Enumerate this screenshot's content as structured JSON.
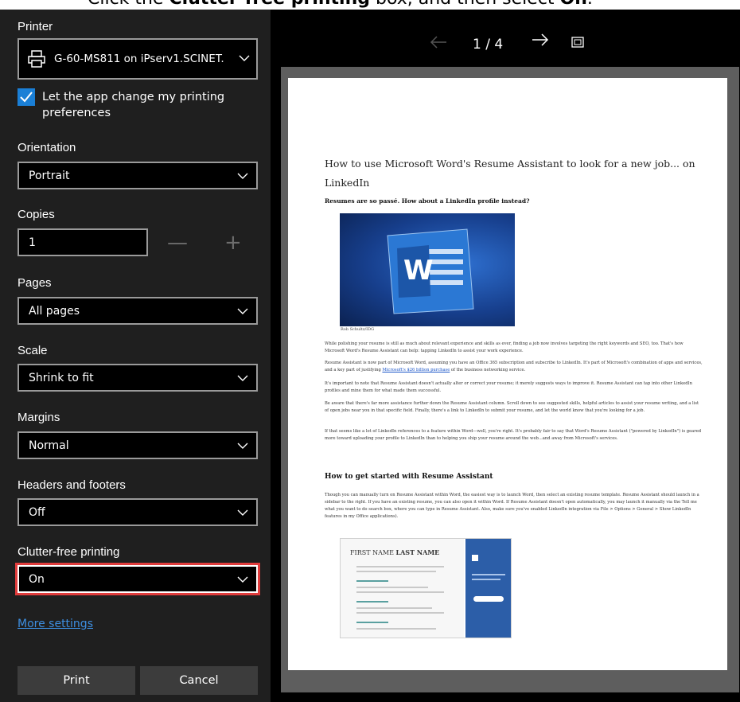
{
  "caption": {
    "prefix": "Click the ",
    "bold_target": "Clutter-free printing",
    "middle": " box, and then select ",
    "bold_option": "On",
    "suffix": "."
  },
  "panel": {
    "printer_label": "Printer",
    "printer_value": "G-60-MS811 on iPserv1.SCINET.",
    "checkbox_label": "Let the app change my printing preferences",
    "checkbox_checked": true,
    "orientation_label": "Orientation",
    "orientation_value": "Portrait",
    "copies_label": "Copies",
    "copies_value": "1",
    "copies_minus": "—",
    "copies_plus": "+",
    "pages_label": "Pages",
    "pages_value": "All pages",
    "scale_label": "Scale",
    "scale_value": "Shrink to fit",
    "margins_label": "Margins",
    "margins_value": "Normal",
    "headers_label": "Headers and footers",
    "headers_value": "Off",
    "clutter_label": "Clutter-free printing",
    "clutter_value": "On",
    "more_settings": "More settings",
    "print_button": "Print",
    "cancel_button": "Cancel"
  },
  "preview": {
    "page_indicator": "1 / 4",
    "doc_title": "How to use Microsoft Word's Resume Assistant to look for a new job... on LinkedIn",
    "doc_subtitle": "Resumes are so passé. How about a LinkedIn profile instead?",
    "image_credit": "Rob Schultz/IDG",
    "hero_letter": "W",
    "para1": "While polishing your resume is still as much about relevant experience and skills as ever, finding a job now involves targeting the right keywords and SEO, too. That's how Microsoft Word's Resume Assistant can help: tapping LinkedIn to assist your work experience.",
    "para2_a": "Resume Assistant is now part of Microsoft Word, assuming you have an Office 365 subscription and subscribe to LinkedIn. It's part of Microsoft's combination of apps and services, and a key part of justifying ",
    "para2_link": "Microsoft's $26 billion purchase",
    "para2_b": " of the business networking service.",
    "para3": "It's important to note that Resume Assistant doesn't actually alter or correct your resume; it merely suggests ways to improve it. Resume Assistant can tap into other LinkedIn profiles and mine them for what made them successful.",
    "para4": "Be aware that there's far more assistance further down the Resume Assistant column. Scroll down to see suggested skills, helpful articles to assist your resume writing, and a list of open jobs near you in that specific field. Finally, there's a link to LinkedIn to submit your resume, and let the world know that you're looking for a job.",
    "para5": "If that seems like a lot of LinkedIn references to a feature within Word—well, you're right. It's probably fair to say that Word's Resume Assistant (\"powered by LinkedIn\") is geared more toward uploading your profile to LinkedIn than to helping you ship your resume around the web...and away from Microsoft's services.",
    "heading2": "How to get started with Resume Assistant",
    "para6": "Though you can manually turn on Resume Assistant within Word, the easiest way is to launch Word, then select an existing resume template. Resume Assistant should launch in a sidebar to the right. If you have an existing resume, you can also open it within Word. If Resume Assistant doesn't open automatically, you may launch it manually via the Tell me what you want to do search box, where you can type in Resume Assistant. Also, make sure you've enabled LinkedIn integration via File > Options > General > Show LinkedIn features in my Office applications).",
    "resume_first": "FIRST NAME ",
    "resume_last": "LAST NAME"
  }
}
